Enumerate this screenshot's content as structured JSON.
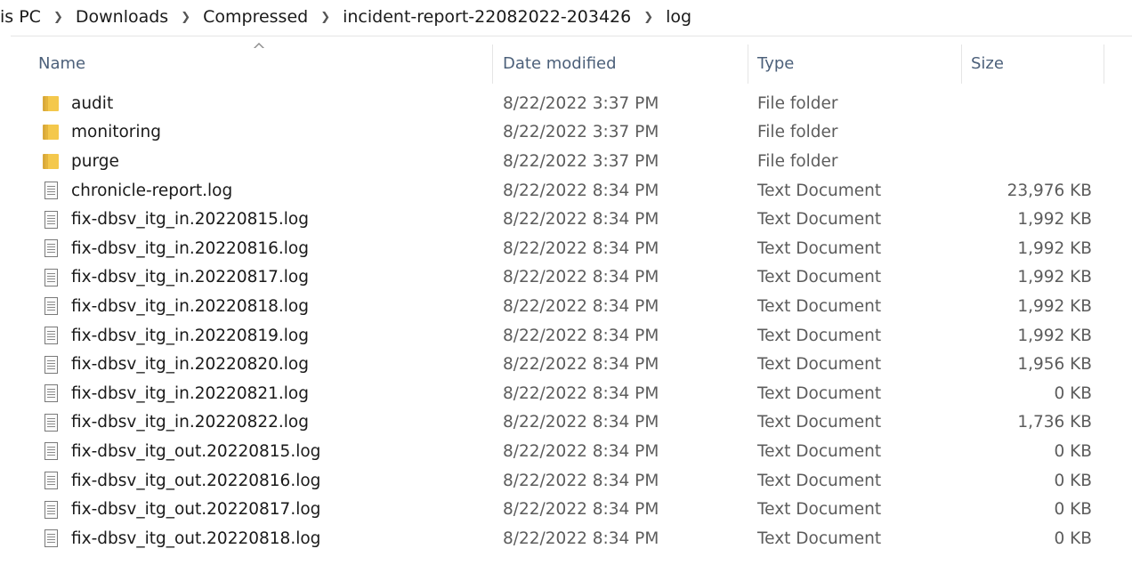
{
  "breadcrumb": [
    "is PC",
    "Downloads",
    "Compressed",
    "incident-report-22082022-203426",
    "log"
  ],
  "columns": {
    "name": "Name",
    "date": "Date modified",
    "type": "Type",
    "size": "Size"
  },
  "files": [
    {
      "name": "audit",
      "date": "8/22/2022 3:37 PM",
      "type": "File folder",
      "size": "",
      "icon": "folder-icon"
    },
    {
      "name": "monitoring",
      "date": "8/22/2022 3:37 PM",
      "type": "File folder",
      "size": "",
      "icon": "folder-icon"
    },
    {
      "name": "purge",
      "date": "8/22/2022 3:37 PM",
      "type": "File folder",
      "size": "",
      "icon": "folder-icon"
    },
    {
      "name": "chronicle-report.log",
      "date": "8/22/2022 8:34 PM",
      "type": "Text Document",
      "size": "23,976 KB",
      "icon": "text-file-icon"
    },
    {
      "name": "fix-dbsv_itg_in.20220815.log",
      "date": "8/22/2022 8:34 PM",
      "type": "Text Document",
      "size": "1,992 KB",
      "icon": "text-file-icon"
    },
    {
      "name": "fix-dbsv_itg_in.20220816.log",
      "date": "8/22/2022 8:34 PM",
      "type": "Text Document",
      "size": "1,992 KB",
      "icon": "text-file-icon"
    },
    {
      "name": "fix-dbsv_itg_in.20220817.log",
      "date": "8/22/2022 8:34 PM",
      "type": "Text Document",
      "size": "1,992 KB",
      "icon": "text-file-icon"
    },
    {
      "name": "fix-dbsv_itg_in.20220818.log",
      "date": "8/22/2022 8:34 PM",
      "type": "Text Document",
      "size": "1,992 KB",
      "icon": "text-file-icon"
    },
    {
      "name": "fix-dbsv_itg_in.20220819.log",
      "date": "8/22/2022 8:34 PM",
      "type": "Text Document",
      "size": "1,992 KB",
      "icon": "text-file-icon"
    },
    {
      "name": "fix-dbsv_itg_in.20220820.log",
      "date": "8/22/2022 8:34 PM",
      "type": "Text Document",
      "size": "1,956 KB",
      "icon": "text-file-icon"
    },
    {
      "name": "fix-dbsv_itg_in.20220821.log",
      "date": "8/22/2022 8:34 PM",
      "type": "Text Document",
      "size": "0 KB",
      "icon": "text-file-icon"
    },
    {
      "name": "fix-dbsv_itg_in.20220822.log",
      "date": "8/22/2022 8:34 PM",
      "type": "Text Document",
      "size": "1,736 KB",
      "icon": "text-file-icon"
    },
    {
      "name": "fix-dbsv_itg_out.20220815.log",
      "date": "8/22/2022 8:34 PM",
      "type": "Text Document",
      "size": "0 KB",
      "icon": "text-file-icon"
    },
    {
      "name": "fix-dbsv_itg_out.20220816.log",
      "date": "8/22/2022 8:34 PM",
      "type": "Text Document",
      "size": "0 KB",
      "icon": "text-file-icon"
    },
    {
      "name": "fix-dbsv_itg_out.20220817.log",
      "date": "8/22/2022 8:34 PM",
      "type": "Text Document",
      "size": "0 KB",
      "icon": "text-file-icon"
    },
    {
      "name": "fix-dbsv_itg_out.20220818.log",
      "date": "8/22/2022 8:34 PM",
      "type": "Text Document",
      "size": "0 KB",
      "icon": "text-file-icon"
    }
  ],
  "colors": {
    "header_text": "#4c607a",
    "secondary_text": "#5c5c5c",
    "folder": "#f4c84c"
  }
}
